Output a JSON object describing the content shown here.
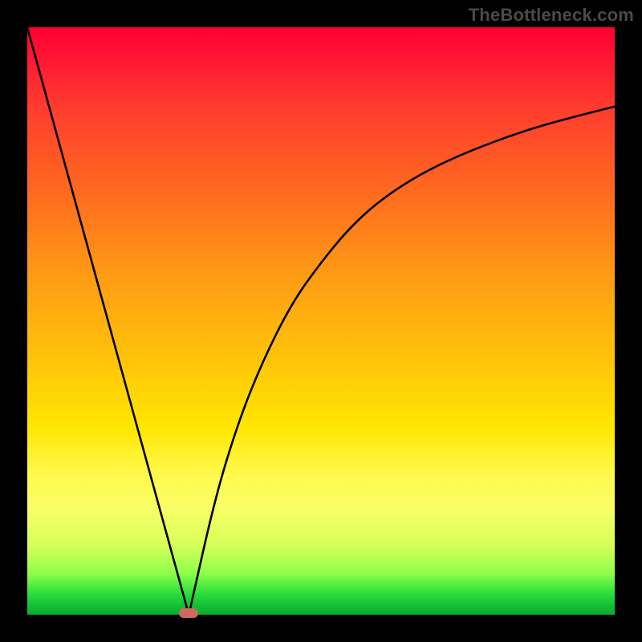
{
  "watermark": {
    "text": "TheBottleneck.com"
  },
  "chart_data": {
    "type": "line",
    "title": "",
    "xlabel": "",
    "ylabel": "",
    "xlim": [
      0,
      100
    ],
    "ylim": [
      0,
      100
    ],
    "grid": false,
    "series": [
      {
        "name": "descending-left",
        "x": [
          0,
          27.5
        ],
        "values": [
          100,
          0
        ]
      },
      {
        "name": "ascending-right",
        "x": [
          27.5,
          32,
          36,
          40,
          45,
          50,
          55,
          60,
          66,
          72,
          78,
          85,
          92,
          100
        ],
        "values": [
          0,
          20,
          33,
          43,
          53,
          60,
          66,
          70.5,
          74.5,
          77.5,
          80,
          82.5,
          84.5,
          86.5
        ]
      }
    ],
    "annotations": [
      {
        "name": "min-marker",
        "x": 27.5,
        "y": 0,
        "color": "#cf6a63"
      }
    ],
    "gradient_stops": [
      {
        "pos": 0,
        "color": "#ff0033"
      },
      {
        "pos": 56,
        "color": "#ffc20a"
      },
      {
        "pos": 76,
        "color": "#fff94c"
      },
      {
        "pos": 100,
        "color": "#0aa92e"
      }
    ]
  }
}
